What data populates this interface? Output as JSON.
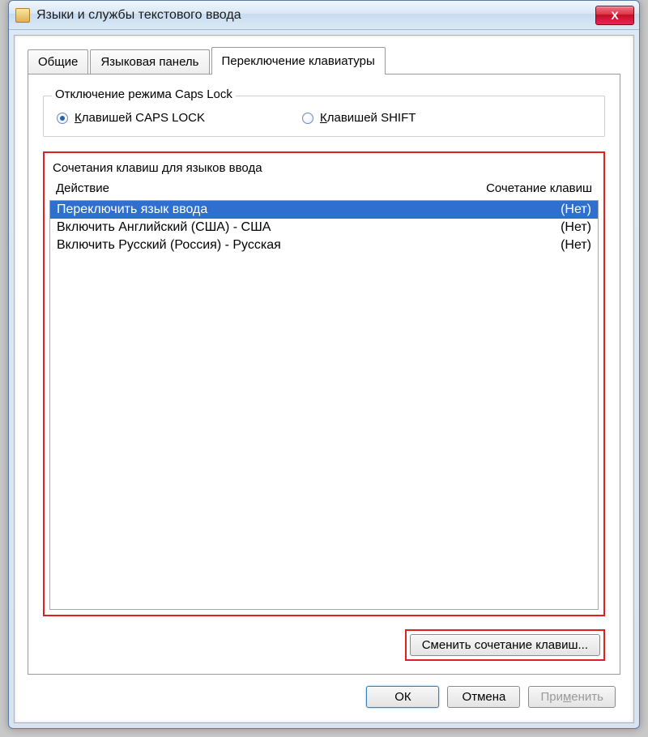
{
  "window": {
    "title": "Языки и службы текстового ввода",
    "close_glyph": "X"
  },
  "tabs": [
    {
      "label": "Общие"
    },
    {
      "label": "Языковая панель"
    },
    {
      "label": "Переключение клавиатуры"
    }
  ],
  "capslock_group": {
    "legend": "Отключение режима Caps Lock",
    "option_caps_pre": "К",
    "option_caps": "лавишей CAPS LOCK",
    "option_shift_pre": "К",
    "option_shift": "лавишей SHIFT"
  },
  "hotkeys": {
    "title": "Сочетания клавиш для языков ввода",
    "col_action": "Действие",
    "col_combo": "Сочетание клавиш",
    "rows": [
      {
        "action": "Переключить язык ввода",
        "combo": "(Нет)",
        "selected": true
      },
      {
        "action": "Включить Английский (США) - США",
        "combo": "(Нет)",
        "selected": false
      },
      {
        "action": "Включить Русский (Россия) - Русская",
        "combo": "(Нет)",
        "selected": false
      }
    ],
    "change_button": "Сменить сочетание клавиш..."
  },
  "buttons": {
    "ok": "ОК",
    "cancel": "Отмена",
    "apply_pre": "При",
    "apply_u": "м",
    "apply_post": "енить"
  }
}
